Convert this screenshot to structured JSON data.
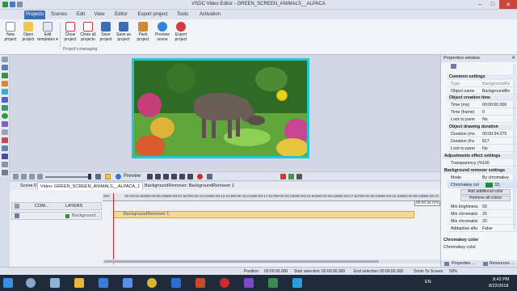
{
  "window": {
    "title": "VSDC Video Editor - GREEN_SCREEN_ANIMALS__ALPACA"
  },
  "menu": {
    "tabs": [
      "Projects",
      "Scenes",
      "Edit",
      "View",
      "Editor",
      "Export project",
      "Tools",
      "Activation"
    ]
  },
  "ribbon": {
    "buttons": [
      "New project",
      "Open project",
      "Edit templates ▾",
      "Close project",
      "Close all projects",
      "Save project",
      "Save as project",
      "Pack project",
      "Preview scene",
      "Export project"
    ],
    "group_label": "Project's managing"
  },
  "preview": {
    "play_label": "Preview"
  },
  "doc_tabs": [
    "Scene 0",
    "Video: GREEN_SCREEN_ANIMALS__ALPACA_1",
    "BackgroundRemover: BackgroundRemover 1"
  ],
  "timeline": {
    "header": {
      "com": "COM...",
      "layers": "LAYERS"
    },
    "ticks": [
      "000",
      "00:00:02.502",
      "00:00:05.005",
      "00:00:07.507",
      "00:00:10.010",
      "00:00:12.512",
      "00:00:15.014",
      "00:00:17.517",
      "00:00:20.020",
      "00:00:22.522",
      "00:00:25.025",
      "00:00:27.527",
      "00:00:30.030",
      "00:00:32.532",
      "00:00:35.035",
      "00:00:37.5"
    ],
    "track_label": "Background...",
    "clip_label": "BackgroundRemover 1",
    "end_time": "00:00:34.075"
  },
  "properties": {
    "title": "Properties window",
    "sections": {
      "common": "Common settings",
      "creation": "Object creation time",
      "drawing": "Object drawing duration",
      "adjust": "Adjustments effect settings",
      "bgremover": "Background remover settings"
    },
    "rows": {
      "type": {
        "k": "Type",
        "v": "BackgroundRe"
      },
      "name": {
        "k": "Object name",
        "v": "BackgroundRe"
      },
      "time_ms": {
        "k": "Time (ms)",
        "v": "00:00:00.000"
      },
      "time_frame": {
        "k": "Time (frame)",
        "v": "0"
      },
      "lock_parent1": {
        "k": "Lock to parer",
        "v": "No"
      },
      "dur_ms": {
        "k": "Duration (ms",
        "v": "00:00:34.075"
      },
      "dur_frames": {
        "k": "Duration (fra",
        "v": "817"
      },
      "lock_parent2": {
        "k": "Lock to parer",
        "v": "No"
      },
      "transparency": {
        "k": "Transparency (%",
        "v": "100"
      },
      "mode": {
        "k": "Mode",
        "v": "By chromakey"
      },
      "chroma": {
        "k": "Chromakey col",
        "v": "33;"
      },
      "min_bright": {
        "k": "Min brightness",
        "v": "50"
      },
      "min_chroma1": {
        "k": "Min chromatici",
        "v": "20"
      },
      "min_chroma2": {
        "k": "Min chromatici",
        "v": "20"
      },
      "addaptive": {
        "k": "Addaptive alfa",
        "v": "False"
      }
    },
    "buttons": {
      "add_color": "Add additional color",
      "remove_colors": "Remove all colors"
    },
    "description": {
      "title": "Chromakey color",
      "text": "Chromakey color"
    },
    "bottom_tabs": [
      "Properties ...",
      "Resources ..."
    ]
  },
  "status": {
    "position": "Position:",
    "position_val": "00:00:00.000",
    "start_sel": "Start selection:",
    "start_sel_val": "00:00:00.000",
    "end_sel": "End selection:",
    "end_sel_val": "00:00:00.000",
    "zoom": "Zoom To Screen",
    "zoom_pct": "50%"
  },
  "taskbar": {
    "lang": "EN",
    "time": "8:42 PM",
    "date": "8/22/2018"
  }
}
